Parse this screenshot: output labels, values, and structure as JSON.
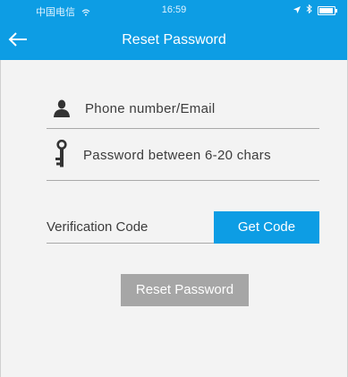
{
  "status_bar": {
    "carrier": "中国电信",
    "time": "16:59",
    "wifi_icon": "wifi-icon",
    "location_icon": "location-arrow-icon",
    "bluetooth_icon": "bluetooth-icon",
    "battery_icon": "battery-icon",
    "battery_level": 1.0
  },
  "navbar": {
    "title": "Reset Password",
    "back_icon": "back-arrow-icon"
  },
  "form": {
    "phone_placeholder": "Phone number/Email",
    "phone_value": "",
    "phone_icon": "user-icon",
    "password_placeholder": "Password between 6-20 chars",
    "password_value": "",
    "password_icon": "key-icon",
    "verification_placeholder": "Verification Code",
    "verification_value": "",
    "get_code_label": "Get Code",
    "reset_label": "Reset Password"
  },
  "colors": {
    "brand": "#0d9de4",
    "button_disabled": "#a6a6a6",
    "background": "#f3f3f3",
    "divider": "#a9a9a9"
  }
}
